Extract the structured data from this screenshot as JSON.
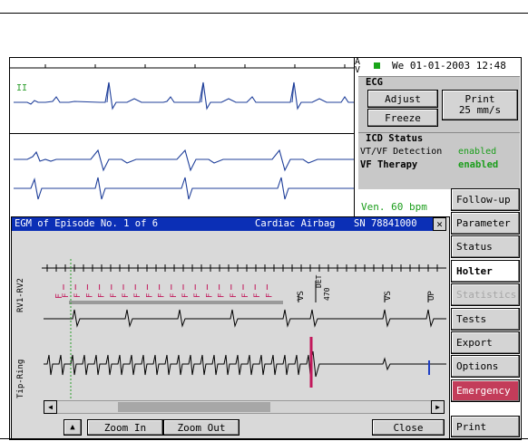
{
  "device": {
    "av_label": "A\nV",
    "datetime": "We 01-01-2003 12:48",
    "lead_label": "II",
    "ecg_panel": {
      "title": "ECG",
      "adjust": "Adjust",
      "freeze": "Freeze",
      "print_label": "Print",
      "print_speed": "25 mm/s"
    },
    "icd_panel": {
      "title": "ICD Status",
      "detection_label": "VT/VF Detection",
      "detection_value": "enabled",
      "therapy_label": "VF Therapy",
      "therapy_value": "enabled"
    },
    "heart_rate": "Ven.  60 bpm",
    "nav": {
      "follow_up": "Follow-up",
      "parameter": "Parameter",
      "status": "Status",
      "holter": "Holter",
      "statistics": "Statistics",
      "tests": "Tests",
      "export": "Export",
      "options": "Options",
      "emergency": "Emergency",
      "print": "Print"
    },
    "colors": {
      "trace": "#1f3f9a",
      "titlebar": "#0b2fb6",
      "emergency": "#c33c5a",
      "enabled": "#1a9d1a",
      "marker_vf": "#c2185b"
    }
  },
  "egm": {
    "title": "EGM of Episode No. 1   of 6",
    "device_name": "Cardiac Airbag",
    "serial": "SN 78841000",
    "close_icon": "x-icon",
    "channel_top": "RV1-RV2",
    "channel_bottom": "Tip-Ring",
    "markers": {
      "vf": "F",
      "vs": "VS",
      "det": "DET",
      "det_value": "470",
      "up": "UP"
    },
    "buttons": {
      "up_arrow": "▲",
      "zoom_in": "Zoom In",
      "zoom_out": "Zoom Out",
      "close": "Close"
    }
  }
}
